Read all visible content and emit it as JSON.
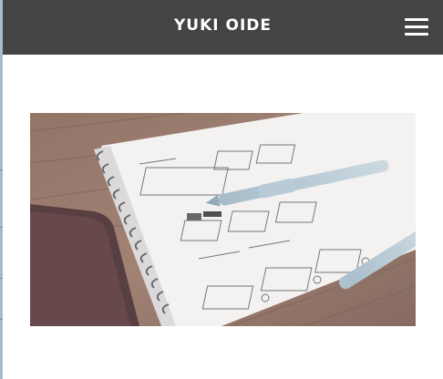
{
  "header": {
    "site_title": "YUKI OIDE",
    "menu_icon": "hamburger-menu-icon"
  },
  "hero": {
    "image_subject": "notebook-wireframe-sketch-photo"
  },
  "colors": {
    "header_bg": "#444444",
    "header_text": "#ffffff",
    "page_bg": "#ffffff"
  }
}
